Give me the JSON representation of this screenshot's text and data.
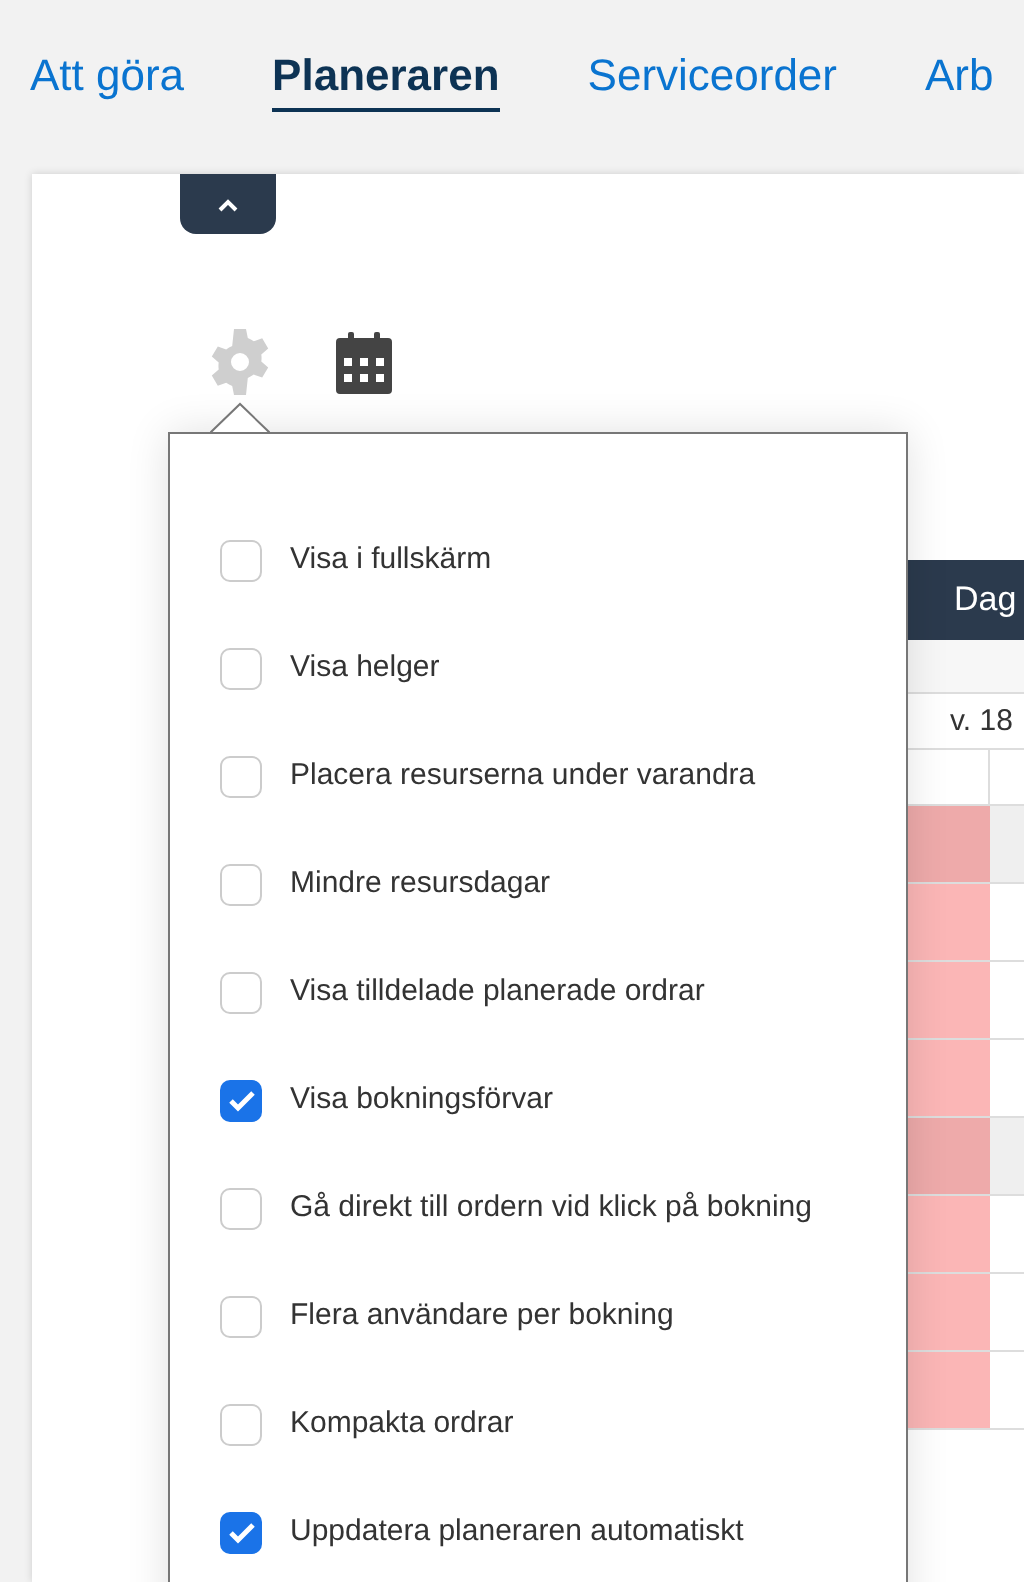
{
  "tabs": [
    {
      "label": "Att göra",
      "selected": false
    },
    {
      "label": "Planeraren",
      "selected": true
    },
    {
      "label": "Serviceorder",
      "selected": false
    },
    {
      "label": "Arb",
      "selected": false
    }
  ],
  "view_button": {
    "label": "Dag"
  },
  "week_label": "v. 18",
  "settings": [
    {
      "label": "Visa i fullskärm",
      "checked": false
    },
    {
      "label": "Visa helger",
      "checked": false
    },
    {
      "label": "Placera resurserna under varandra",
      "checked": false
    },
    {
      "label": "Mindre resursdagar",
      "checked": false
    },
    {
      "label": "Visa tilldelade planerade ordrar",
      "checked": false
    },
    {
      "label": "Visa bokningsförvar",
      "checked": true
    },
    {
      "label": "Gå direkt till ordern vid klick på bokning",
      "checked": false
    },
    {
      "label": "Flera användare per bokning",
      "checked": false
    },
    {
      "label": "Kompakta ordrar",
      "checked": false
    },
    {
      "label": "Uppdatera planeraren automatiskt",
      "checked": true
    }
  ]
}
